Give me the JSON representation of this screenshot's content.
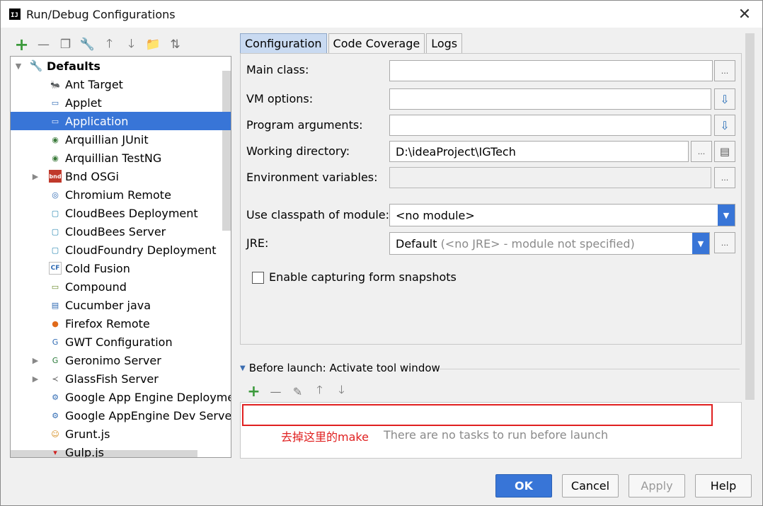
{
  "window": {
    "app_icon_text": "IJ",
    "title": "Run/Debug Configurations",
    "close_glyph": "✕"
  },
  "left_toolbar": [
    {
      "name": "add-icon",
      "glyph": "+"
    },
    {
      "name": "remove-icon",
      "glyph": "—"
    },
    {
      "name": "copy-icon",
      "glyph": "❐"
    },
    {
      "name": "wrench-icon",
      "glyph": "🔧"
    },
    {
      "name": "move-up-icon",
      "glyph": "🡑"
    },
    {
      "name": "move-down-icon",
      "glyph": "🡓"
    },
    {
      "name": "folder-icon",
      "glyph": "📁"
    },
    {
      "name": "sort-icon",
      "glyph": "⇅"
    }
  ],
  "tree": {
    "root_label": "Defaults",
    "selected": "Application",
    "items": [
      {
        "label": "Ant Target",
        "icon": "ant-icon",
        "expandable": false
      },
      {
        "label": "Applet",
        "icon": "applet-icon",
        "expandable": false
      },
      {
        "label": "Application",
        "icon": "application-icon",
        "expandable": false
      },
      {
        "label": "Arquillian JUnit",
        "icon": "arquillian-icon",
        "expandable": false
      },
      {
        "label": "Arquillian TestNG",
        "icon": "arquillian-icon",
        "expandable": false
      },
      {
        "label": "Bnd OSGi",
        "icon": "bnd-icon",
        "expandable": true
      },
      {
        "label": "Chromium Remote",
        "icon": "chromium-icon",
        "expandable": false
      },
      {
        "label": "CloudBees Deployment",
        "icon": "cloud-icon",
        "expandable": false
      },
      {
        "label": "CloudBees Server",
        "icon": "cloud-icon",
        "expandable": false
      },
      {
        "label": "CloudFoundry Deployment",
        "icon": "cloud-icon",
        "expandable": false
      },
      {
        "label": "Cold Fusion",
        "icon": "coldfusion-icon",
        "expandable": false
      },
      {
        "label": "Compound",
        "icon": "compound-icon",
        "expandable": false
      },
      {
        "label": "Cucumber java",
        "icon": "cucumber-icon",
        "expandable": false
      },
      {
        "label": "Firefox Remote",
        "icon": "firefox-icon",
        "expandable": false
      },
      {
        "label": "GWT Configuration",
        "icon": "gwt-icon",
        "expandable": false
      },
      {
        "label": "Geronimo Server",
        "icon": "geronimo-icon",
        "expandable": true
      },
      {
        "label": "GlassFish Server",
        "icon": "glassfish-icon",
        "expandable": true
      },
      {
        "label": "Google App Engine Deploymer",
        "icon": "appengine-icon",
        "expandable": false
      },
      {
        "label": "Google AppEngine Dev Server",
        "icon": "appengine-icon",
        "expandable": false
      },
      {
        "label": "Grunt.js",
        "icon": "grunt-icon",
        "expandable": false
      },
      {
        "label": "Gulp.js",
        "icon": "gulp-icon",
        "expandable": false
      }
    ]
  },
  "tabs": [
    {
      "label": "Configuration",
      "active": true
    },
    {
      "label": "Code Coverage",
      "active": false
    },
    {
      "label": "Logs",
      "active": false
    }
  ],
  "form": {
    "main_class_label": "Main class:",
    "main_class_value": "",
    "vm_options_label": "VM options:",
    "vm_options_value": "",
    "program_args_label": "Program arguments:",
    "program_args_value": "",
    "working_dir_label": "Working directory:",
    "working_dir_value": "D:\\ideaProject\\IGTech",
    "env_vars_label": "Environment variables:",
    "env_vars_value": "",
    "classpath_label": "Use classpath of module:",
    "classpath_value": "<no module>",
    "jre_label": "JRE:",
    "jre_value": "Default",
    "jre_hint": "(<no JRE> - module not specified)",
    "snapshot_label": "Enable capturing form snapshots",
    "snapshot_checked": false,
    "ellipsis": "...",
    "expand_glyph": "⇩",
    "doc_glyph": "▤"
  },
  "before_launch": {
    "title": "Before launch: Activate tool window",
    "toolbar": [
      {
        "name": "add-task-icon",
        "glyph": "+"
      },
      {
        "name": "remove-task-icon",
        "glyph": "—"
      },
      {
        "name": "edit-task-icon",
        "glyph": "✎"
      },
      {
        "name": "task-up-icon",
        "glyph": "🡑"
      },
      {
        "name": "task-down-icon",
        "glyph": "🡓"
      }
    ],
    "annotation": "去掉这里的make",
    "empty_text": "There are no tasks to run before launch"
  },
  "footer": {
    "ok": "OK",
    "cancel": "Cancel",
    "apply": "Apply",
    "help": "Help"
  },
  "colors": {
    "selection": "#3875d7",
    "annotation": "#e02020",
    "add_green": "#3c9a3c"
  }
}
